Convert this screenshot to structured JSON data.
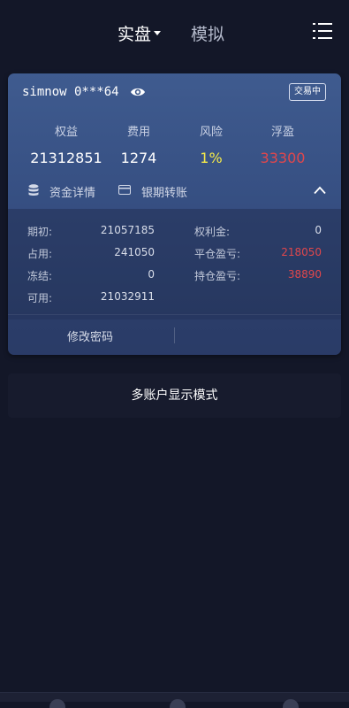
{
  "header": {
    "tab_real": "实盘",
    "tab_sim": "模拟",
    "menu_icon": "list-menu-icon"
  },
  "account": {
    "name": "simnow 0***64",
    "eye_icon": "eye-icon",
    "status": "交易中"
  },
  "stats": [
    {
      "label": "权益",
      "value": "21312851",
      "color": "white"
    },
    {
      "label": "费用",
      "value": "1274",
      "color": "white"
    },
    {
      "label": "风险",
      "value": "1%",
      "color": "yellow"
    },
    {
      "label": "浮盈",
      "value": "33300",
      "color": "red"
    }
  ],
  "actions": {
    "funds_detail": "资金详情",
    "bank_transfer": "银期转账",
    "funds_icon": "database-icon",
    "transfer_icon": "card-icon",
    "collapse_icon": "chevron-up-icon"
  },
  "details_left": [
    {
      "label": "期初:",
      "value": "21057185"
    },
    {
      "label": "占用:",
      "value": "241050"
    },
    {
      "label": "冻结:",
      "value": "0"
    },
    {
      "label": "可用:",
      "value": "21032911"
    }
  ],
  "details_right": [
    {
      "label": "权利金:",
      "value": "0"
    },
    {
      "label": "平仓盈亏:",
      "value": "218050"
    },
    {
      "label": "持仓盈亏:",
      "value": "38890"
    }
  ],
  "bottom": {
    "change_password": "修改密码"
  },
  "multi_account": {
    "label": "多账户显示模式"
  },
  "colors": {
    "background": "#131728",
    "card_top": "#3f5b8f",
    "card_bottom": "#2c3f6c",
    "profit_red": "#e0474c",
    "risk_yellow": "#f4e94a"
  }
}
